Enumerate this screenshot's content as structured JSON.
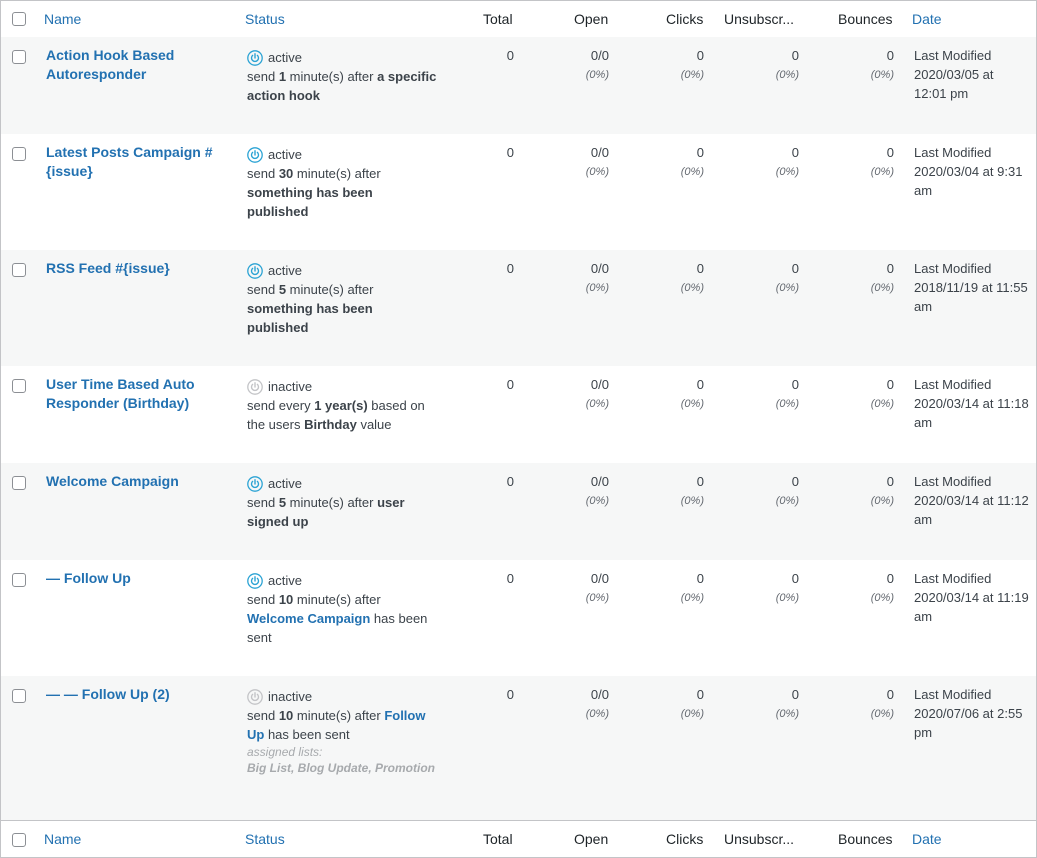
{
  "columns": {
    "name": "Name",
    "status": "Status",
    "total": "Total",
    "open": "Open",
    "clicks": "Clicks",
    "unsubscribes": "Unsubscr...",
    "bounces": "Bounces",
    "date": "Date"
  },
  "colors": {
    "link": "#2271b1",
    "active": "#2ba3d4",
    "inactive": "#c3c4c7"
  },
  "rows": [
    {
      "title": "Action Hook Based Autoresponder",
      "state": "active",
      "status_text": "active",
      "desc_html": "send <b>1</b> minute(s) after <b>a specific action hook</b>",
      "lists_label": "",
      "lists_value": "",
      "total": "0",
      "open": "0/0",
      "open_pct": "(0%)",
      "clicks": "0",
      "clicks_pct": "(0%)",
      "unsub": "0",
      "unsub_pct": "(0%)",
      "bounces": "0",
      "bounces_pct": "(0%)",
      "date_label": "Last Modified",
      "date_value": "2020/03/05 at 12:01 pm"
    },
    {
      "title": "Latest Posts Campaign #{issue}",
      "state": "active",
      "status_text": "active",
      "desc_html": "send <b>30</b> minute(s) after <b>something has been published</b>",
      "lists_label": "",
      "lists_value": "",
      "total": "0",
      "open": "0/0",
      "open_pct": "(0%)",
      "clicks": "0",
      "clicks_pct": "(0%)",
      "unsub": "0",
      "unsub_pct": "(0%)",
      "bounces": "0",
      "bounces_pct": "(0%)",
      "date_label": "Last Modified",
      "date_value": "2020/03/04 at 9:31 am"
    },
    {
      "title": "RSS Feed #{issue}",
      "state": "active",
      "status_text": "active",
      "desc_html": "send <b>5</b> minute(s) after <b>something has been published</b>",
      "lists_label": "",
      "lists_value": "",
      "total": "0",
      "open": "0/0",
      "open_pct": "(0%)",
      "clicks": "0",
      "clicks_pct": "(0%)",
      "unsub": "0",
      "unsub_pct": "(0%)",
      "bounces": "0",
      "bounces_pct": "(0%)",
      "date_label": "Last Modified",
      "date_value": "2018/11/19 at 11:55 am"
    },
    {
      "title": "User Time Based Auto Responder (Birthday)",
      "state": "inactive",
      "status_text": "inactive",
      "desc_html": "send every <b>1 year(s)</b> based on the users <b>Birthday</b> value",
      "lists_label": "",
      "lists_value": "",
      "total": "0",
      "open": "0/0",
      "open_pct": "(0%)",
      "clicks": "0",
      "clicks_pct": "(0%)",
      "unsub": "0",
      "unsub_pct": "(0%)",
      "bounces": "0",
      "bounces_pct": "(0%)",
      "date_label": "Last Modified",
      "date_value": "2020/03/14 at 11:18 am"
    },
    {
      "title": "Welcome Campaign",
      "state": "active",
      "status_text": "active",
      "desc_html": "send <b>5</b> minute(s) after <b>user signed up</b>",
      "lists_label": "",
      "lists_value": "",
      "total": "0",
      "open": "0/0",
      "open_pct": "(0%)",
      "clicks": "0",
      "clicks_pct": "(0%)",
      "unsub": "0",
      "unsub_pct": "(0%)",
      "bounces": "0",
      "bounces_pct": "(0%)",
      "date_label": "Last Modified",
      "date_value": "2020/03/14 at 11:12 am"
    },
    {
      "title": "— Follow Up",
      "state": "active",
      "status_text": "active",
      "desc_html": "send <b>10</b> minute(s) after <a>Welcome Campaign</a> has been sent",
      "lists_label": "",
      "lists_value": "",
      "total": "0",
      "open": "0/0",
      "open_pct": "(0%)",
      "clicks": "0",
      "clicks_pct": "(0%)",
      "unsub": "0",
      "unsub_pct": "(0%)",
      "bounces": "0",
      "bounces_pct": "(0%)",
      "date_label": "Last Modified",
      "date_value": "2020/03/14 at 11:19 am"
    },
    {
      "title": "— — Follow Up (2)",
      "state": "inactive",
      "status_text": "inactive",
      "desc_html": "send <b>10</b> minute(s) after <a>Follow Up</a> has been sent",
      "lists_label": "assigned lists:",
      "lists_value": "Big List, Blog Update, Promotion",
      "total": "0",
      "open": "0/0",
      "open_pct": "(0%)",
      "clicks": "0",
      "clicks_pct": "(0%)",
      "unsub": "0",
      "unsub_pct": "(0%)",
      "bounces": "0",
      "bounces_pct": "(0%)",
      "date_label": "Last Modified",
      "date_value": "2020/07/06 at 2:55 pm"
    }
  ]
}
